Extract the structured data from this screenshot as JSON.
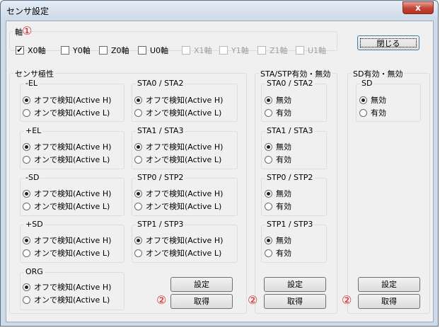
{
  "window": {
    "title": "センサ設定",
    "close_label": "x"
  },
  "axis_group": {
    "label": "軸",
    "marker": "①",
    "checkboxes": [
      {
        "label": "X0軸",
        "checked": true,
        "enabled": true
      },
      {
        "label": "Y0軸",
        "checked": false,
        "enabled": true
      },
      {
        "label": "Z0軸",
        "checked": false,
        "enabled": true
      },
      {
        "label": "U0軸",
        "checked": false,
        "enabled": true
      },
      {
        "label": "X1軸",
        "checked": false,
        "enabled": false
      },
      {
        "label": "Y1軸",
        "checked": false,
        "enabled": false
      },
      {
        "label": "Z1軸",
        "checked": false,
        "enabled": false
      },
      {
        "label": "U1軸",
        "checked": false,
        "enabled": false
      }
    ]
  },
  "close_button": {
    "label": "閉じる"
  },
  "polarity": {
    "label": "センサ極性",
    "groups": {
      "el_minus": {
        "label": "-EL",
        "opt1": "オフで検知(Active H)",
        "opt2": "オンで検知(Active L)",
        "selected": 1
      },
      "el_plus": {
        "label": "+EL",
        "opt1": "オフで検知(Active H)",
        "opt2": "オンで検知(Active L)",
        "selected": 1
      },
      "sd_minus": {
        "label": "-SD",
        "opt1": "オフで検知(Active H)",
        "opt2": "オンで検知(Active L)",
        "selected": 1
      },
      "sd_plus": {
        "label": "+SD",
        "opt1": "オフで検知(Active H)",
        "opt2": "オンで検知(Active L)",
        "selected": 1
      },
      "org": {
        "label": "ORG",
        "opt1": "オフで検知(Active H)",
        "opt2": "オンで検知(Active L)",
        "selected": 1
      },
      "sta0": {
        "label": "STA0 / STA2",
        "opt1": "オフで検知(Active H)",
        "opt2": "オンで検知(Active L)",
        "selected": 1
      },
      "sta1": {
        "label": "STA1 / STA3",
        "opt1": "オフで検知(Active H)",
        "opt2": "オンで検知(Active L)",
        "selected": 1
      },
      "stp0": {
        "label": "STP0 / STP2",
        "opt1": "オフで検知(Active H)",
        "opt2": "オンで検知(Active L)",
        "selected": 1
      },
      "stp1": {
        "label": "STP1 / STP3",
        "opt1": "オフで検知(Active H)",
        "opt2": "オンで検知(Active L)",
        "selected": 1
      }
    },
    "set_label": "設定",
    "get_label": "取得",
    "marker": "②"
  },
  "stastp": {
    "label": "STA/STP有効・無効",
    "groups": {
      "sta0": {
        "label": "STA0 / STA2",
        "opt1": "無効",
        "opt2": "有効",
        "selected": 1
      },
      "sta1": {
        "label": "STA1 / STA3",
        "opt1": "無効",
        "opt2": "有効",
        "selected": 1
      },
      "stp0": {
        "label": "STP0 / STP2",
        "opt1": "無効",
        "opt2": "有効",
        "selected": 1
      },
      "stp1": {
        "label": "STP1 / STP3",
        "opt1": "無効",
        "opt2": "有効",
        "selected": 1
      }
    },
    "set_label": "設定",
    "get_label": "取得",
    "marker": "②"
  },
  "sd": {
    "label": "SD有効・無効",
    "group": {
      "label": "SD",
      "opt1": "無効",
      "opt2": "有効",
      "selected": 1
    },
    "set_label": "設定",
    "get_label": "取得",
    "marker": "②"
  }
}
